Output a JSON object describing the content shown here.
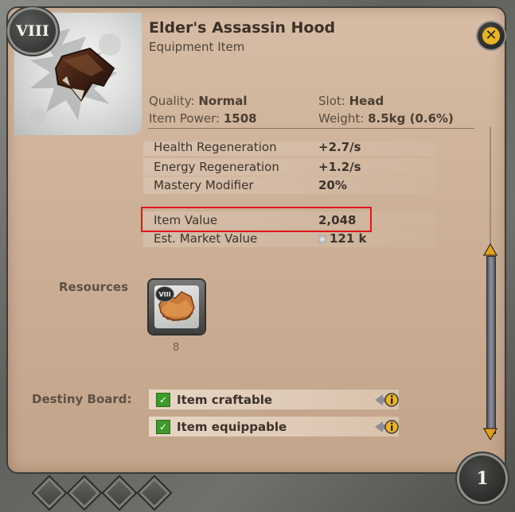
{
  "item": {
    "tier": "VIII",
    "name": "Elder's Assassin Hood",
    "type": "Equipment Item"
  },
  "stats": {
    "quality_label": "Quality:",
    "quality_value": "Normal",
    "slot_label": "Slot:",
    "slot_value": "Head",
    "power_label": "Item Power:",
    "power_value": "1508",
    "weight_label": "Weight:",
    "weight_value": "8.5kg (0.6%)"
  },
  "attributes": [
    {
      "label": "Health Regeneration",
      "value": "+2.7/s"
    },
    {
      "label": "Energy Regeneration",
      "value": "+1.2/s"
    },
    {
      "label": "Mastery Modifier",
      "value": "20%"
    },
    {
      "label": "Item Value",
      "value": "2,048"
    },
    {
      "label": "Est. Market Value",
      "value": "121 k"
    }
  ],
  "resources": {
    "label": "Resources",
    "items": [
      {
        "tier": "VIII",
        "count": "8",
        "icon": "leather-icon"
      }
    ]
  },
  "destiny_board": {
    "label": "Destiny Board:",
    "rows": [
      {
        "text": "Item craftable",
        "checked": true
      },
      {
        "text": "Item equippable",
        "checked": true
      }
    ]
  },
  "footer": {
    "page": "1"
  },
  "colors": {
    "highlight": "#e0161c",
    "close_accent": "#e9b525",
    "check": "#3e9a2a"
  }
}
